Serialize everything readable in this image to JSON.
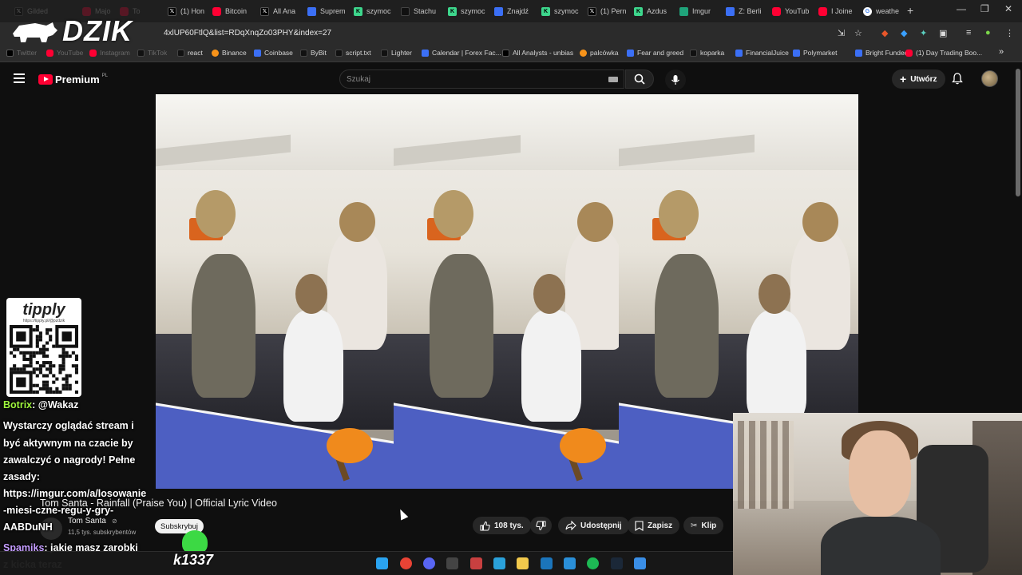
{
  "browser": {
    "tabs": [
      {
        "label": "Gilded",
        "icon": "x"
      },
      {
        "label": "Majo",
        "icon": "yt"
      },
      {
        "label": "To",
        "icon": "yt"
      },
      {
        "label": "(1) Hon",
        "icon": "x"
      },
      {
        "label": "Bitcoin",
        "icon": "yt"
      },
      {
        "label": "All Ana",
        "icon": "x"
      },
      {
        "label": "Suprem",
        "icon": "blue"
      },
      {
        "label": "szymoc",
        "icon": "k"
      },
      {
        "label": "Stachu",
        "icon": "tt"
      },
      {
        "label": "szymoc",
        "icon": "k"
      },
      {
        "label": "Znajdź",
        "icon": "blue"
      },
      {
        "label": "szymoc",
        "icon": "k"
      },
      {
        "label": "(1) Pern",
        "icon": "x"
      },
      {
        "label": "Azdus",
        "icon": "k"
      },
      {
        "label": "Imgur",
        "icon": "green"
      },
      {
        "label": "Z: Berli",
        "icon": "blue"
      },
      {
        "label": "YouTub",
        "icon": "yt"
      },
      {
        "label": "I Joine",
        "icon": "yt"
      },
      {
        "label": "weathe",
        "icon": "g"
      }
    ],
    "new_tab": "+",
    "window_controls": [
      "—",
      "❐",
      "✕"
    ],
    "url": "4xlUP60FtlQ&list=RDqXnqZo03PHY&index=27",
    "bookmarks": [
      {
        "label": "Twitter",
        "icon": "x",
        "faded": true
      },
      {
        "label": "YouTube",
        "icon": "yt",
        "faded": true
      },
      {
        "label": "Instagram",
        "icon": "yt",
        "faded": true
      },
      {
        "label": "TikTok",
        "icon": "tt",
        "faded": true
      },
      {
        "label": "react",
        "icon": "tt"
      },
      {
        "label": "Binance",
        "icon": "orange"
      },
      {
        "label": "Coinbase",
        "icon": "blue"
      },
      {
        "label": "ByBit",
        "icon": "tt"
      },
      {
        "label": "script.txt",
        "icon": "tt"
      },
      {
        "label": "Lighter",
        "icon": "tt"
      },
      {
        "label": "Calendar | Forex Fac...",
        "icon": "blue"
      },
      {
        "label": "All Analysts - unbias",
        "icon": "x"
      },
      {
        "label": "palcówka",
        "icon": "orange"
      },
      {
        "label": "Fear and greed",
        "icon": "blue"
      },
      {
        "label": "koparka",
        "icon": "tt"
      },
      {
        "label": "FinancialJuice",
        "icon": "blue"
      },
      {
        "label": "Polymarket",
        "icon": "blue"
      },
      {
        "label": "Bright Funded",
        "icon": "blue"
      },
      {
        "label": "(1) Day Trading Boo...",
        "icon": "yt"
      }
    ]
  },
  "stream_logo": "DZIK",
  "youtube": {
    "logo_word": "Premium",
    "region": "PL",
    "search_placeholder": "Szukaj",
    "create_label": "Utwórz",
    "video": {
      "title": "Tom Santa - Rainfall (Praise You) | Official Lyric Video",
      "channel": "Tom Santa",
      "subscribers": "11,5 tys. subskrybentów",
      "subscribe_label": "Subskrybuj",
      "likes": "108 tys.",
      "share_label": "Udostępnij",
      "save_label": "Zapisz",
      "clip_label": "Klip"
    }
  },
  "overlay": {
    "tipply_title": "tipply",
    "tipply_url": "https://tipply.pl/@pzdzik",
    "chat": [
      {
        "user": "Botrix",
        "text": ": @Wakaz",
        "partial": true
      },
      {
        "user": "",
        "text": "Wystarczy oglądać stream i"
      },
      {
        "user": "",
        "text": "być aktywnym na czacie by"
      },
      {
        "user": "",
        "text": "zawalczyć o nagrody! Pełne"
      },
      {
        "user": "",
        "text": "zasady:"
      },
      {
        "user": "",
        "text": "https://imgur.com/a/losowanie"
      },
      {
        "user": "",
        "text": "-miesi-czne-regu-y-gry-"
      },
      {
        "user": "",
        "text": "AABDuNH"
      },
      {
        "user": "Spamiks",
        "text": ": jakie masz zarobki"
      },
      {
        "user": "",
        "text": "z kicka teraz"
      }
    ],
    "badge": "k1337"
  },
  "colors": {
    "accent_red": "#ff0033",
    "chat_green": "#9ef53d",
    "chat_purple": "#c49cff",
    "table_blue": "#4d5fc2",
    "paddle_orange": "#f08a1c"
  }
}
